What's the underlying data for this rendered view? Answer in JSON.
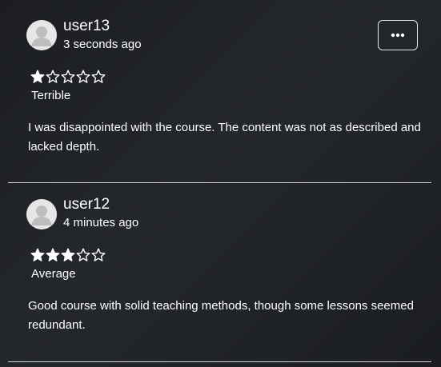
{
  "reviews": [
    {
      "username": "user13",
      "timestamp": "3 seconds ago",
      "rating": 1,
      "max_rating": 5,
      "rating_label": "Terrible",
      "body": "I was disappointed with the course. The content was not as described and lacked depth.",
      "avatar_icon": "user-placeholder-icon"
    },
    {
      "username": "user12",
      "timestamp": "4 minutes ago",
      "rating": 3,
      "max_rating": 5,
      "rating_label": "Average",
      "body": "Good course with solid teaching methods, though some lessons seemed redundant.",
      "avatar_icon": "user-placeholder-icon"
    }
  ],
  "more_button": {
    "icon": "more-horizontal-icon"
  },
  "colors": {
    "background": "#1f2226",
    "text": "#ffffff",
    "divider": "#d9d9d9",
    "avatar_bg": "#e6e6e6",
    "avatar_fg": "#bdbdbd"
  }
}
